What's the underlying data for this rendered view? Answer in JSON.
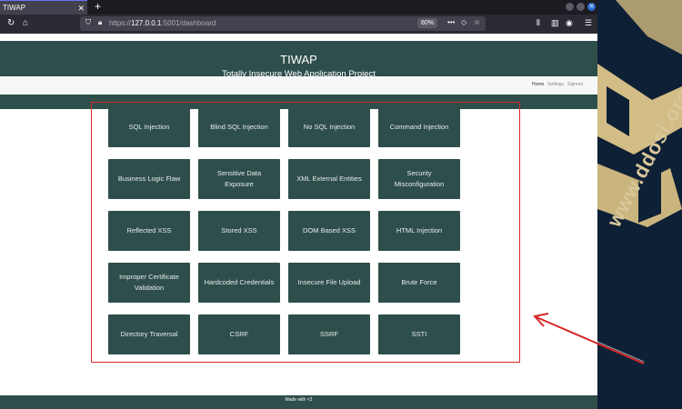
{
  "browser": {
    "tab_title": "TIWAP",
    "tab_close": "✕",
    "new_tab": "+",
    "url_scheme": "https://",
    "url_host": "127.0.0.1",
    "url_rest": ":5001/dashboard",
    "zoom": "60%"
  },
  "header": {
    "title": "TIWAP",
    "subtitle": "Totally Insecure Web Application Project"
  },
  "nav": {
    "home": "Home",
    "settings": "Settings",
    "signout": "Signout"
  },
  "cards": [
    "SQL Injection",
    "Blind SQL Injection",
    "No SQL Injection",
    "Command Injection",
    "Business Logic Flaw",
    "Sensitive Data Exposure",
    "XML External Entities",
    "Security Misconfiguration",
    "Reflected XSS",
    "Stored XSS",
    "DOM Based XSS",
    "HTML Injection",
    "Improper Certificate Validation",
    "Hardcoded Credentials",
    "Insecure File Upload",
    "Brute Force",
    "Directory Traversal",
    "CSRF",
    "SSRF",
    "SSTI"
  ],
  "footer": "Made with <3",
  "wallpaper_text": "www.ddosi.org",
  "colors": {
    "accent": "#2e4e4b",
    "highlight": "#d62828",
    "wallpaper": "#0e2036"
  }
}
